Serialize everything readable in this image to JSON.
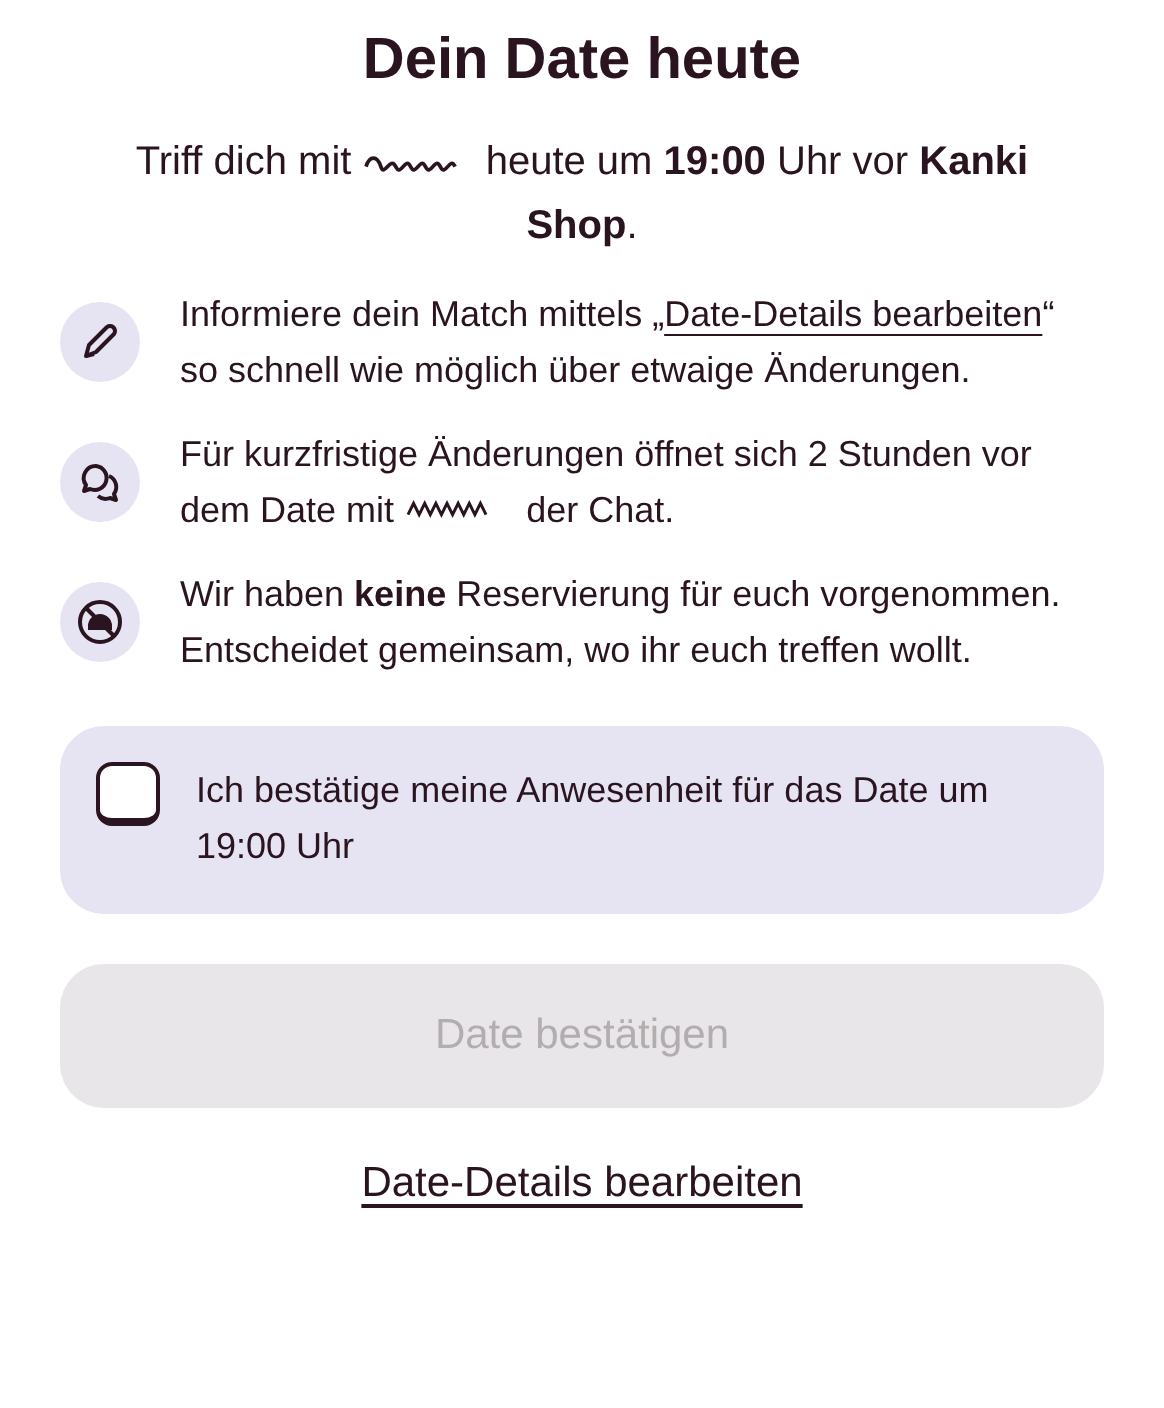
{
  "title": "Dein Date heute",
  "intro": [
    {
      "kind": "text",
      "text": "Triff dich mit"
    },
    {
      "kind": "redacted"
    },
    {
      "kind": "text",
      "text": "heute um **19:00** Uhr vor **Kanki Shop**."
    }
  ],
  "info": [
    {
      "kind": "pencil",
      "parts": [
        {
          "kind": "text",
          "text": "Informiere dein Match mittels „"
        },
        {
          "kind": "link",
          "text": "Date-Details bearbeiten"
        },
        {
          "kind": "text",
          "text": "“ so schnell wie möglich über etwaige Änderungen."
        }
      ]
    },
    {
      "kind": "chat",
      "parts": [
        {
          "kind": "text",
          "text": "Für kurzfristige Änderungen öffnet sich 2 Stunden vor dem Date mit"
        },
        {
          "kind": "redacted"
        },
        {
          "kind": "text",
          "text": "der Chat."
        }
      ]
    },
    {
      "kind": "cloche",
      "parts": [
        {
          "kind": "text",
          "text": "Wir haben **keine** Reservierung für euch vorgenommen. Entscheidet gemeinsam, wo ihr euch treffen wollt."
        }
      ]
    }
  ],
  "confirm": {
    "label": "Ich bestätige meine Anwesenheit für das Date um 19:00 Uhr",
    "checked": false
  },
  "button": {
    "label": "Date bestätigen",
    "disabled": true
  },
  "link": "Date-Details bearbeiten"
}
